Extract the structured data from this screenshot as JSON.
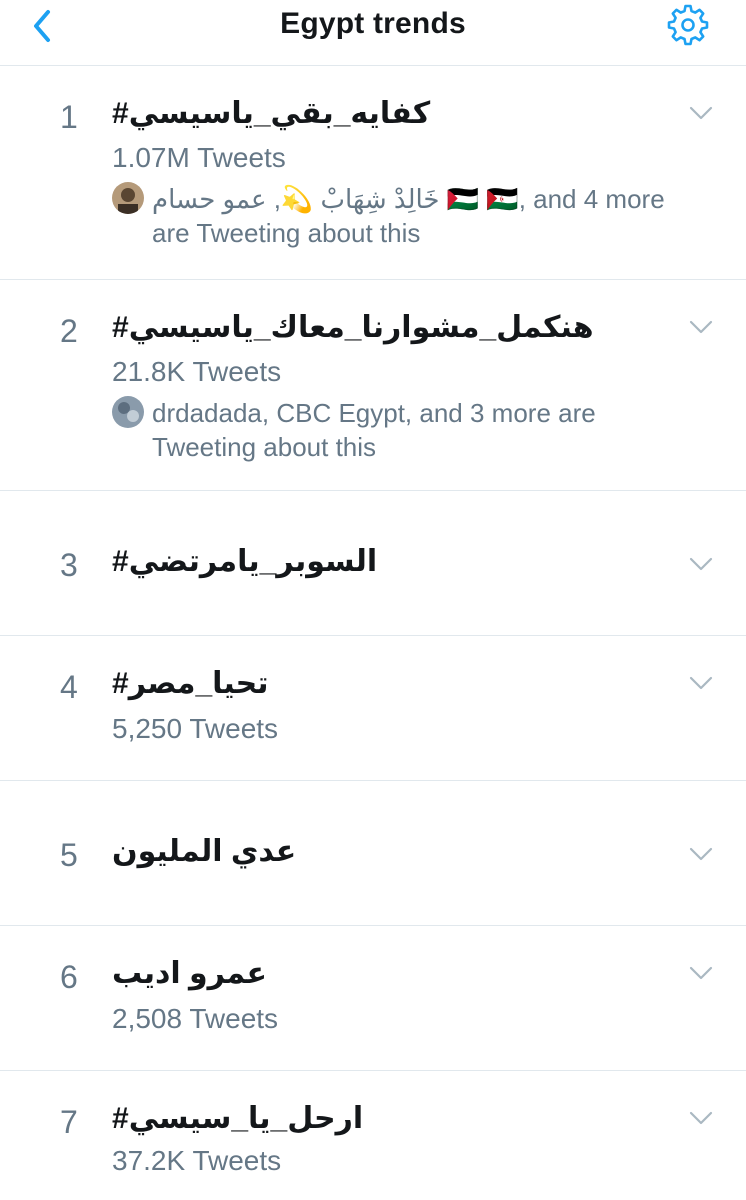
{
  "header": {
    "title": "Egypt trends",
    "back_icon": "chevron-left-icon",
    "settings_icon": "gear-icon"
  },
  "colors": {
    "accent": "#1da1f2",
    "muted": "#657786",
    "text": "#14171a",
    "divider": "#e1e8ed"
  },
  "trends": [
    {
      "rank": "1",
      "name": "#كفايه_بقي_ياسيسي",
      "count": "1.07M Tweets",
      "context_line1": "خَالِدْ شِهَابْ 💫, عمو حسام 🇵🇸 🇪🇭, and 4 more",
      "context_line2": "are Tweeting about this"
    },
    {
      "rank": "2",
      "name": "#هنكمل_مشوارنا_معاك_ياسيسي",
      "count": "21.8K Tweets",
      "context_line1": "drdadada, CBC Egypt, and 3 more are",
      "context_line2": "Tweeting about this"
    },
    {
      "rank": "3",
      "name": "#السوبر_يامرتضي"
    },
    {
      "rank": "4",
      "name": "#تحيا_مصر",
      "count": "5,250 Tweets"
    },
    {
      "rank": "5",
      "name": "عدي المليون"
    },
    {
      "rank": "6",
      "name": "عمرو اديب",
      "count": "2,508 Tweets"
    },
    {
      "rank": "7",
      "name": "#ارحل_يا_سيسي",
      "count": "37.2K Tweets"
    }
  ]
}
